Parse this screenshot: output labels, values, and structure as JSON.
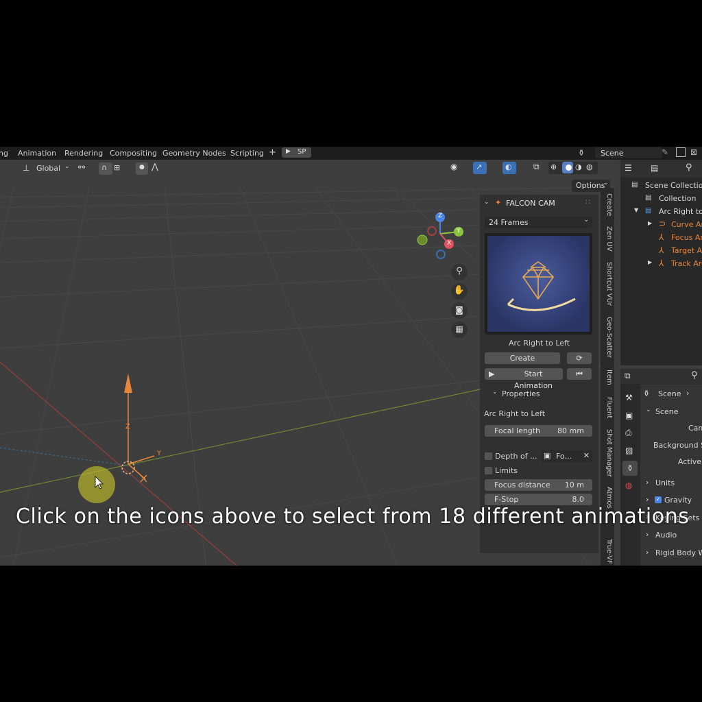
{
  "topbar": {
    "tabs": [
      "ng",
      "Animation",
      "Rendering",
      "Compositing",
      "Geometry Nodes",
      "Scripting"
    ],
    "add_label": "+",
    "sp_label": "SP",
    "scene_label": "Scene"
  },
  "viewport_header": {
    "orientation_label": "Global",
    "options_label": "Options"
  },
  "gizmo": {
    "x": "X",
    "y": "Y",
    "z": "Z"
  },
  "falcon_cam": {
    "title": "FALCON CAM",
    "frames": "24 Frames",
    "preview_name": "Arc Right to Left",
    "create_label": "Create",
    "start_label": "Start Animation",
    "properties_label": "Properties",
    "preset_name": "Arc Right to Left",
    "focal_label": "Focal length",
    "focal_value": "80 mm",
    "dof_label": "Depth of ...",
    "dof_object": "Fo...",
    "limits_label": "Limits",
    "focus_label": "Focus distance",
    "focus_value": "10 m",
    "fstop_label": "F-Stop",
    "fstop_value": "8.0"
  },
  "sidebar_tabs": [
    "Create",
    "Zen UV",
    "Shortcut VUr",
    "Geo-Scatter",
    "Item",
    "Fluent",
    "Shot Manager",
    "Atmos",
    "True-VF"
  ],
  "outliner": {
    "rows": [
      {
        "label": "Scene Collection",
        "color": "#d0d0d0"
      },
      {
        "label": "Collection",
        "color": "#d0d0d0"
      },
      {
        "label": "Arc Right to L",
        "color": "#d0d0d0"
      },
      {
        "label": "Curve Arc",
        "color": "#e8873a"
      },
      {
        "label": "Focus Arc",
        "color": "#e8873a"
      },
      {
        "label": "Target Ar",
        "color": "#e8873a"
      },
      {
        "label": "Track Arc",
        "color": "#e8873a"
      }
    ]
  },
  "properties": {
    "scene_label": "Scene",
    "section_label": "Scene",
    "camera_label": "Cam",
    "background_label": "Background Sc",
    "active_label": "Active",
    "units_label": "Units",
    "gravity_label": "Gravity",
    "keying_label": "Keying Sets",
    "audio_label": "Audio",
    "rigid_label": "Rigid Body Wo"
  },
  "axis_labels": {
    "z": "Z",
    "y": "Y"
  },
  "caption": "Click on the icons above to select from 18 different animations",
  "colors": {
    "accent_orange": "#e8873a",
    "viewport": "#3e3e3e",
    "panel": "#303030",
    "x_axis": "#9a3b3b",
    "y_axis": "#6f8a2f"
  }
}
